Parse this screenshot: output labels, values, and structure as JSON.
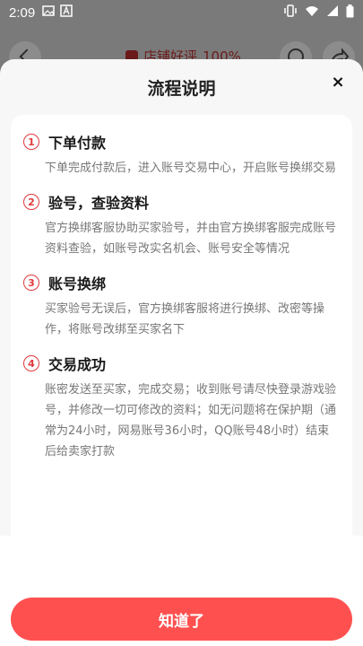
{
  "status_bar": {
    "time": "2:09"
  },
  "background": {
    "title": "店铺好评",
    "rating": "100%"
  },
  "sheet": {
    "title": "流程说明",
    "close_label": "×",
    "steps": [
      {
        "num": "1",
        "title": "下单付款",
        "desc": "下单完成付款后，进入账号交易中心，开启账号换绑交易"
      },
      {
        "num": "2",
        "title": "验号，查验资料",
        "desc": "官方换绑客服协助买家验号，并由官方换绑客服完成账号资料查验，如账号改实名机会、账号安全等情况"
      },
      {
        "num": "3",
        "title": "账号换绑",
        "desc": "买家验号无误后，官方换绑客服将进行换绑、改密等操作，将账号改绑至买家名下"
      },
      {
        "num": "4",
        "title": "交易成功",
        "desc": "账密发送至买家，完成交易；收到账号请尽快登录游戏验号，并修改一切可修改的资料；如无问题将在保护期（通常为24小时，网易账号36小时，QQ账号48小时）结束后给卖家打款"
      }
    ],
    "confirm_button": "知道了"
  },
  "colors": {
    "accent": "#e0393d",
    "button": "#ff5050"
  }
}
